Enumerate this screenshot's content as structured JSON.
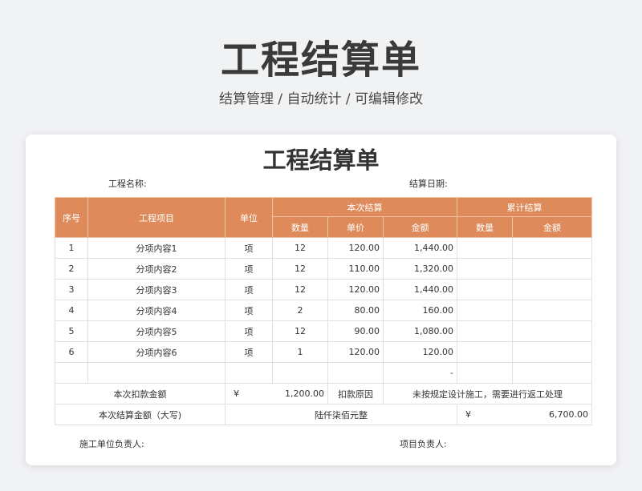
{
  "header": {
    "title": "工程结算单",
    "subtitle": "结算管理 /  自动统计  /  可编辑修改"
  },
  "document": {
    "title": "工程结算单",
    "project_name_label": "工程名称:",
    "settle_date_label": "结算日期:",
    "contractor_sign_label": "施工单位负责人:",
    "project_sign_label": "项目负责人:"
  },
  "table": {
    "headers": {
      "no": "序号",
      "item": "工程项目",
      "unit": "单位",
      "current_group": "本次结算",
      "cumulative_group": "累计结算",
      "qty": "数量",
      "price": "单价",
      "amount": "金额",
      "cum_qty": "数量",
      "cum_amount": "金额"
    },
    "rows": [
      {
        "no": "1",
        "item": "分项内容1",
        "unit": "项",
        "qty": "12",
        "price": "120.00",
        "amount": "1,440.00",
        "cum_qty": "",
        "cum_amount": ""
      },
      {
        "no": "2",
        "item": "分项内容2",
        "unit": "项",
        "qty": "12",
        "price": "110.00",
        "amount": "1,320.00",
        "cum_qty": "",
        "cum_amount": ""
      },
      {
        "no": "3",
        "item": "分项内容3",
        "unit": "项",
        "qty": "12",
        "price": "120.00",
        "amount": "1,440.00",
        "cum_qty": "",
        "cum_amount": ""
      },
      {
        "no": "4",
        "item": "分项内容4",
        "unit": "项",
        "qty": "2",
        "price": "80.00",
        "amount": "160.00",
        "cum_qty": "",
        "cum_amount": ""
      },
      {
        "no": "5",
        "item": "分项内容5",
        "unit": "项",
        "qty": "12",
        "price": "90.00",
        "amount": "1,080.00",
        "cum_qty": "",
        "cum_amount": ""
      },
      {
        "no": "6",
        "item": "分项内容6",
        "unit": "项",
        "qty": "1",
        "price": "120.00",
        "amount": "120.00",
        "cum_qty": "",
        "cum_amount": ""
      },
      {
        "no": "",
        "item": "",
        "unit": "",
        "qty": "",
        "price": "",
        "amount": "-",
        "cum_qty": "",
        "cum_amount": ""
      }
    ],
    "deduction": {
      "label": "本次扣款金额",
      "currency": "¥",
      "amount": "1,200.00",
      "reason_label": "扣款原因",
      "reason": "未按规定设计施工，需要进行返工处理"
    },
    "total": {
      "label": "本次结算金额（大写)",
      "words": "陆仟柒佰元整",
      "currency": "¥",
      "amount": "6,700.00"
    }
  },
  "colors": {
    "header_bg": "#de8a5a",
    "page_bg": "#f1f2f4"
  }
}
